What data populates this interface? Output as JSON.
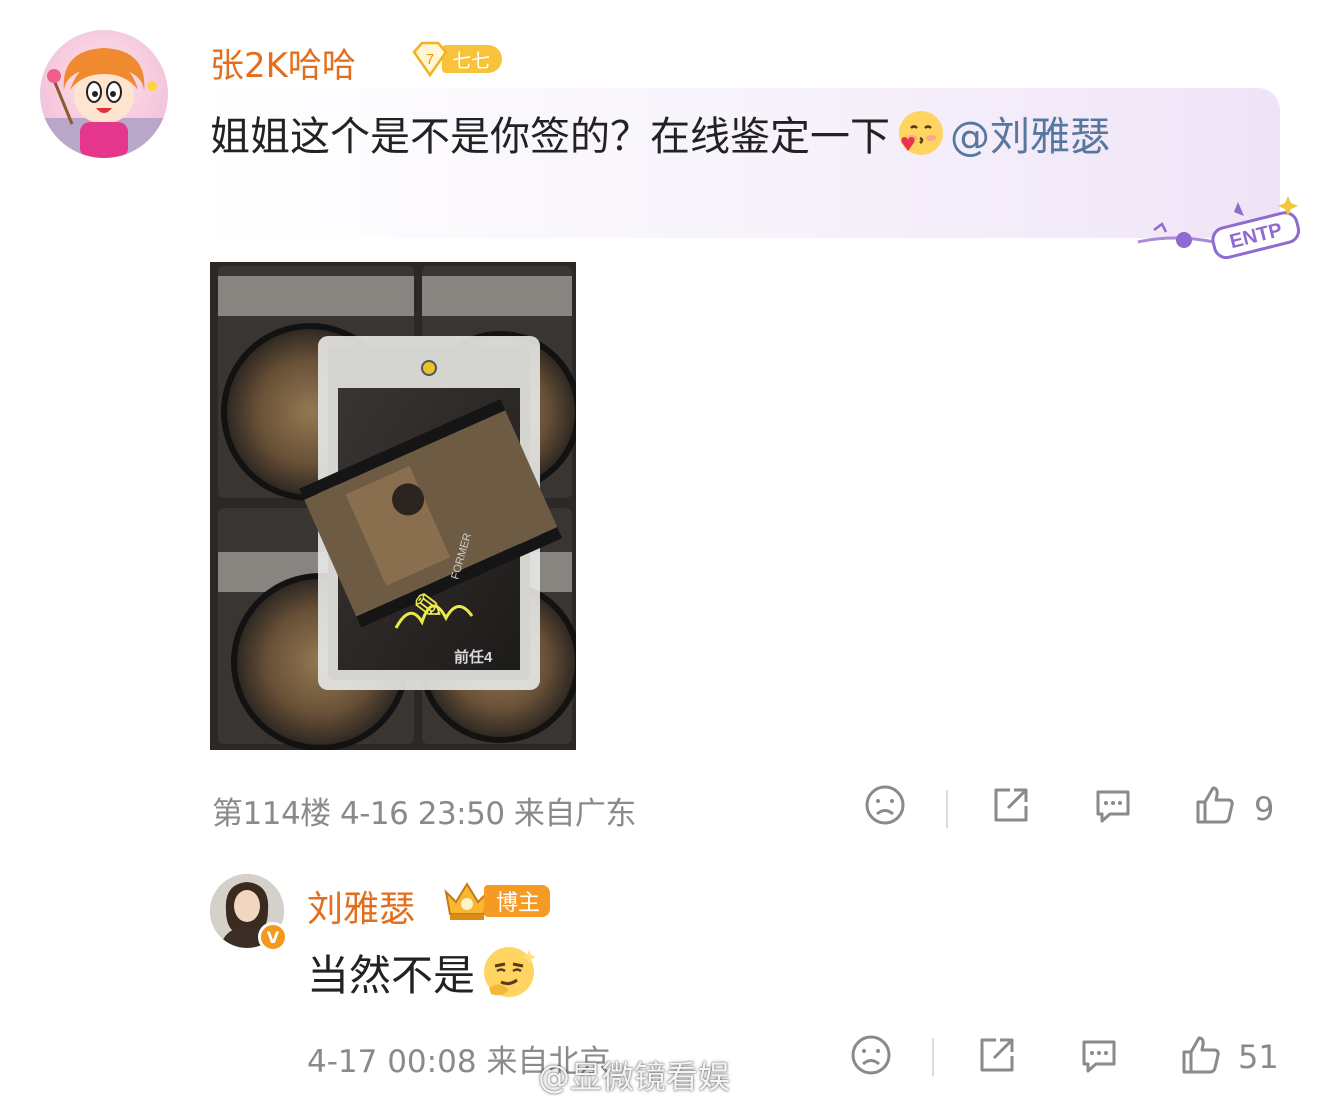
{
  "comments": [
    {
      "username": "张2K哈哈",
      "fan_badge": {
        "level": "7",
        "label": "七七"
      },
      "text_before_emoji": "姐姐这个是不是你签的？在线鉴定一下",
      "emoji": "heart-kiss-emoji",
      "mention": "@刘雅瑟",
      "bubble_sticker": "ENTP",
      "photo_texts": {
        "title": "前任4",
        "subtitle": "FORMER"
      },
      "floor_info": "第114楼 4-16 23:50 来自广东",
      "likes": "9"
    },
    {
      "username": "刘雅瑟",
      "verified_badge": "V",
      "role_badge": "博主",
      "text": "当然不是",
      "emoji": "smug-emoji",
      "meta": "4-17 00:08 来自北京",
      "likes": "51"
    }
  ],
  "watermark": "@显微镜看娱",
  "colors": {
    "username": "#e46e1b",
    "mention": "#56789e",
    "meta": "#8a8a8a",
    "badge_orange": "#f59a23"
  }
}
